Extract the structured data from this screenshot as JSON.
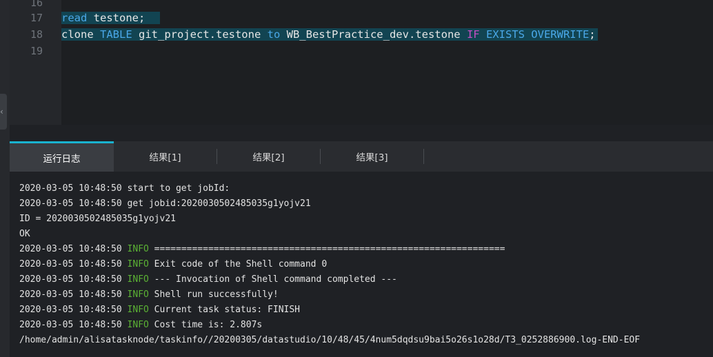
{
  "editor": {
    "lines": [
      {
        "num": "16",
        "text": ""
      },
      {
        "num": "17",
        "kw_read": "read",
        "rest": " testone;"
      },
      {
        "num": "18",
        "t1": "clone ",
        "t2": "TABLE",
        "t3": " git_project.testone ",
        "t4": "to",
        "t5": " WB_BestPractice_dev.testone ",
        "t6": "IF",
        "t7": " ",
        "t8": "EXISTS",
        "t9": " ",
        "t10": "OVERWRITE",
        "t11": ";"
      },
      {
        "num": "19",
        "text": ""
      }
    ]
  },
  "collapse_icon": "chevron-left-icon",
  "collapse_glyph": "‹",
  "tabs": [
    {
      "label": "运行日志"
    },
    {
      "label": "结果[1]"
    },
    {
      "label": "结果[2]"
    },
    {
      "label": "结果[3]"
    }
  ],
  "log": [
    {
      "ts": "2020-03-05 10:48:50",
      "level": "",
      "msg": " start to get jobId:"
    },
    {
      "ts": "2020-03-05 10:48:50",
      "level": "",
      "msg": " get jobid:2020030502485035g1yojv21"
    },
    {
      "ts": "",
      "level": "",
      "msg": "ID = 2020030502485035g1yojv21"
    },
    {
      "ts": "",
      "level": "",
      "msg": "OK"
    },
    {
      "ts": "2020-03-05 10:48:50",
      "level": " INFO",
      "msg": " ================================================================="
    },
    {
      "ts": "2020-03-05 10:48:50",
      "level": " INFO",
      "msg": " Exit code of the Shell command 0"
    },
    {
      "ts": "2020-03-05 10:48:50",
      "level": " INFO",
      "msg": " --- Invocation of Shell command completed ---"
    },
    {
      "ts": "2020-03-05 10:48:50",
      "level": " INFO",
      "msg": " Shell run successfully!"
    },
    {
      "ts": "2020-03-05 10:48:50",
      "level": " INFO",
      "msg": " Current task status: FINISH"
    },
    {
      "ts": "2020-03-05 10:48:50",
      "level": " INFO",
      "msg": " Cost time is: 2.807s"
    },
    {
      "ts": "",
      "level": "",
      "msg": "/home/admin/alisatasknode/taskinfo//20200305/datastudio/10/48/45/4num5dqdsu9bai5o26s1o28d/T3_0252886900.log-END-EOF"
    }
  ],
  "colors": {
    "accent": "#19b3cf",
    "info": "#5bb134",
    "keyword": "#4aa8e8",
    "keyword_conditional": "#c44fc4",
    "selection": "#124452"
  }
}
